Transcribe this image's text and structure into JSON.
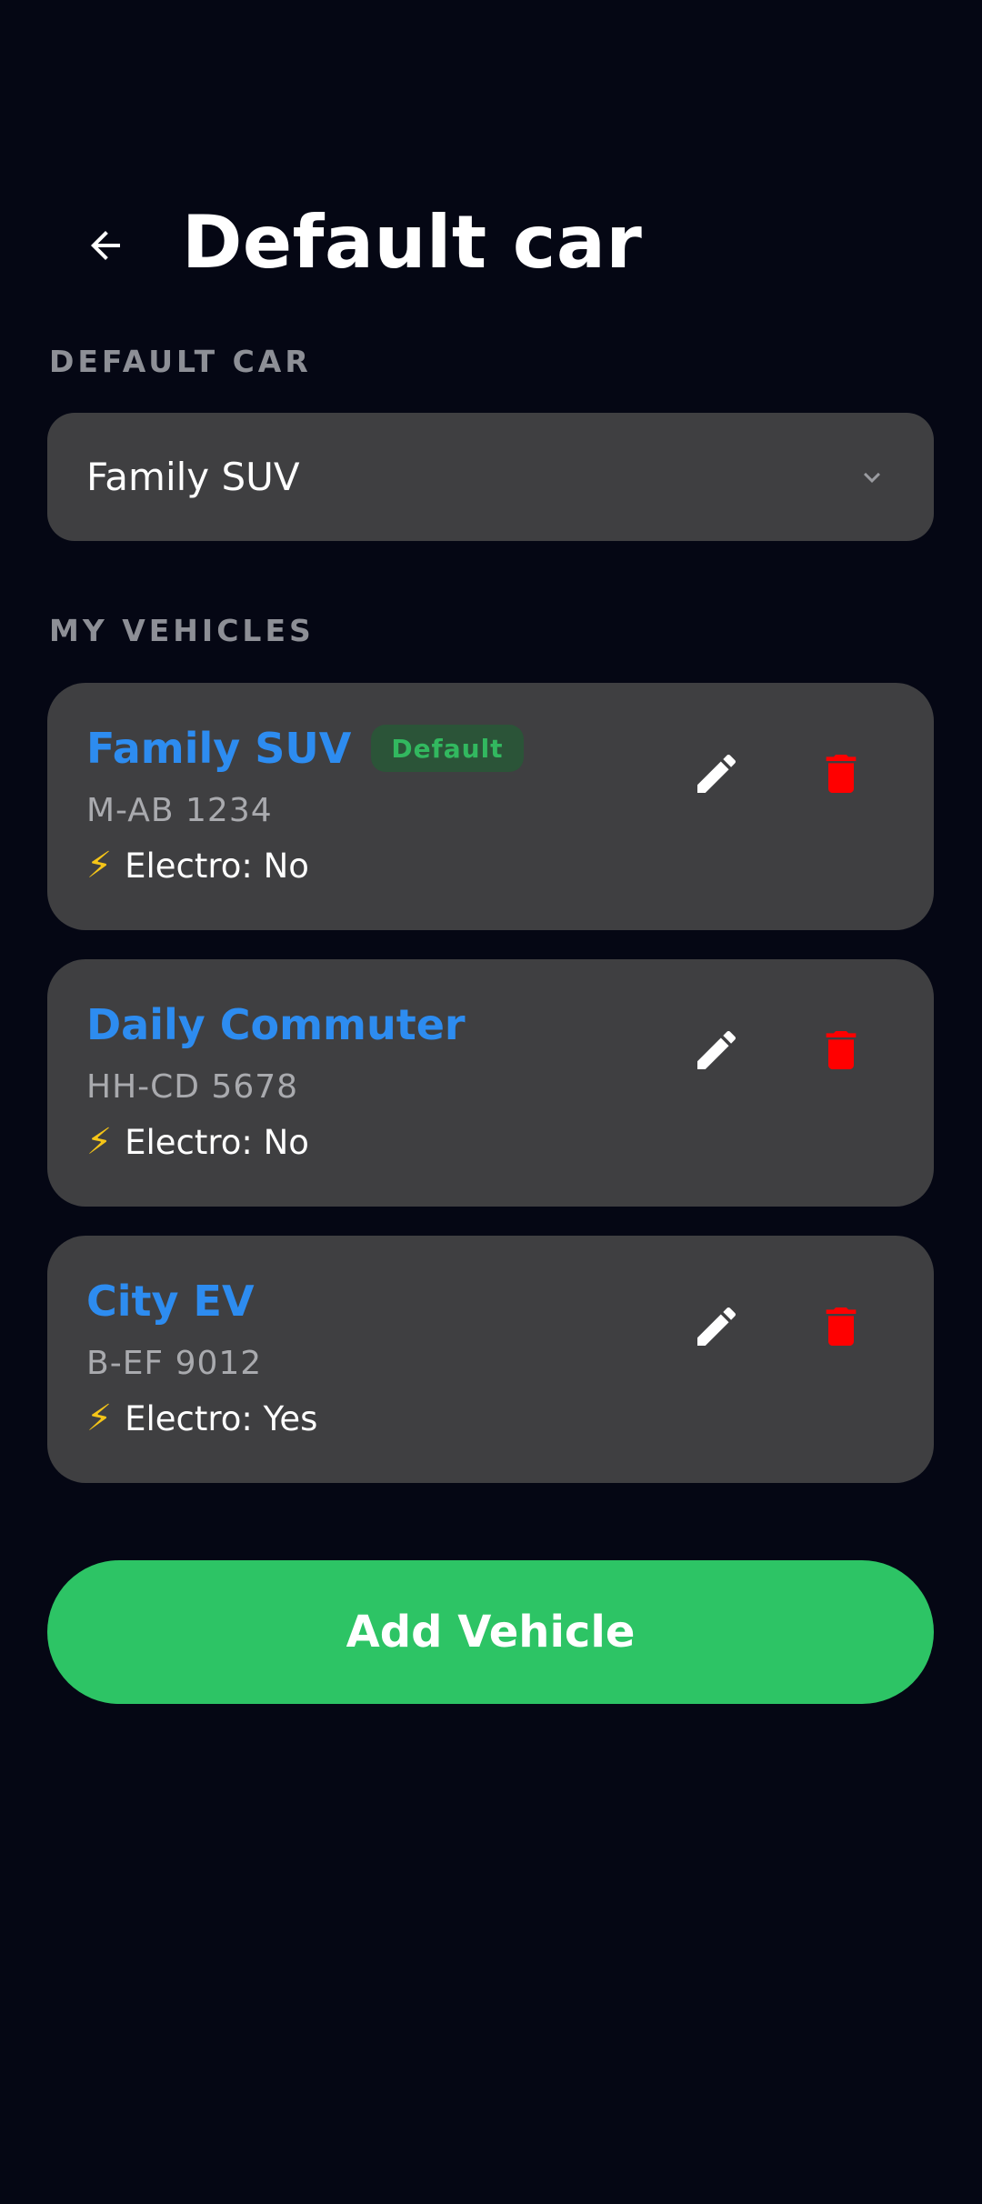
{
  "header": {
    "title": "Default car",
    "back_icon": "arrow-left-icon"
  },
  "default_car_section": {
    "label": "DEFAULT CAR",
    "selected_value": "Family SUV",
    "dropdown_icon": "chevron-down-icon"
  },
  "vehicles_section": {
    "label": "MY VEHICLES",
    "vehicles": [
      {
        "name": "Family SUV",
        "badge": "Default",
        "plate": "M-AB 1234",
        "electro_icon": "lightning-bolt-icon",
        "electro_label": "Electro: No"
      },
      {
        "name": "Daily Commuter",
        "badge": "",
        "plate": "HH-CD 5678",
        "electro_icon": "lightning-bolt-icon",
        "electro_label": "Electro: No"
      },
      {
        "name": "City EV",
        "badge": "",
        "plate": "B-EF 9012",
        "electro_icon": "lightning-bolt-icon",
        "electro_label": "Electro: Yes"
      }
    ]
  },
  "add_button": {
    "label": "Add Vehicle"
  },
  "colors": {
    "background": "#050714",
    "card": "#3f3f41",
    "vehicle_name": "#2d8cf0",
    "badge_text": "#32b85f",
    "badge_bg": "#2b5438",
    "delete_icon": "#ff0000",
    "add_button": "#2dc465",
    "section_label": "#8d8f96"
  }
}
